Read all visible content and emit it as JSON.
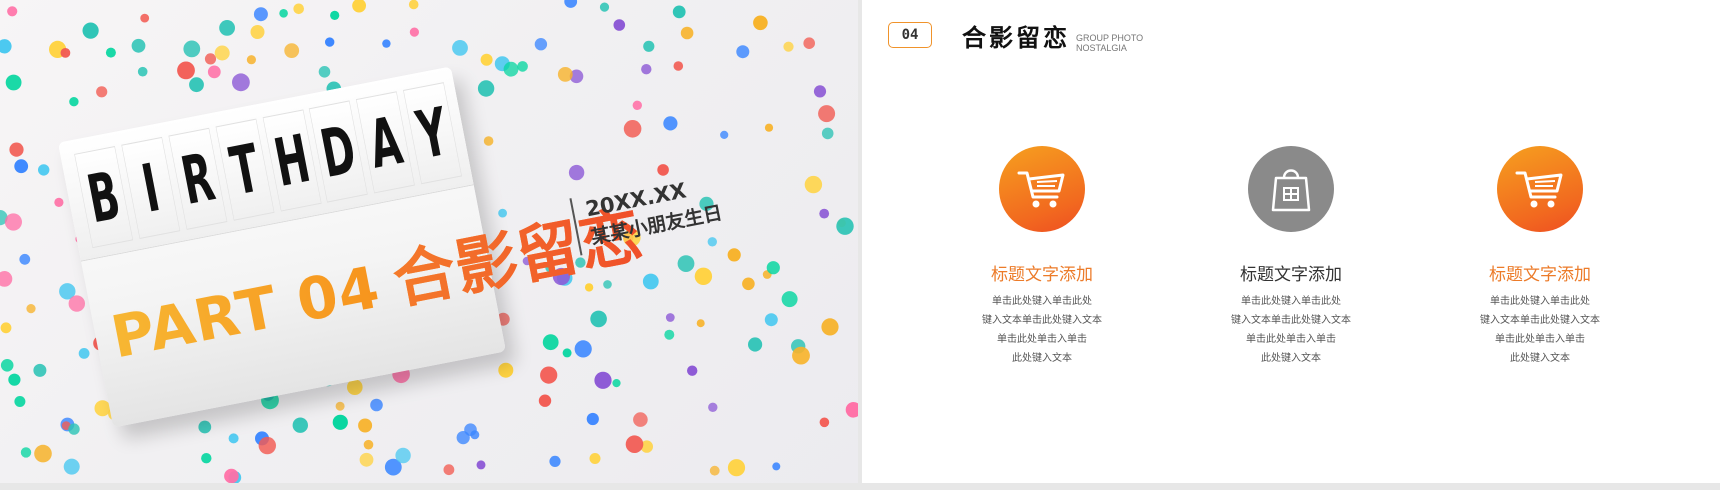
{
  "left_slide": {
    "letters": [
      "B",
      "I",
      "R",
      "T",
      "H",
      "D",
      "A",
      "Y"
    ],
    "part_label": "PART 04",
    "part_title_cn": "合影留恋",
    "date": "20XX.XX",
    "party_name": "某某小朋友生日"
  },
  "right_slide": {
    "badge": "04",
    "title": "合影留恋",
    "subtitle_line1": "GROUP PHOTO",
    "subtitle_line2": "NOSTALGIA",
    "features": [
      {
        "icon": "shopping-cart-icon",
        "title": "标题文字添加",
        "lines": [
          "单击此处键入单击此处",
          "键入文本单击此处键入文本",
          "单击此处单击入单击",
          "此处键入文本"
        ]
      },
      {
        "icon": "shopping-bag-icon",
        "title": "标题文字添加",
        "lines": [
          "单击此处键入单击此处",
          "键入文本单击此处键入文本",
          "单击此处单击入单击",
          "此处键入文本"
        ]
      },
      {
        "icon": "shopping-cart-icon",
        "title": "标题文字添加",
        "lines": [
          "单击此处键入单击此处",
          "键入文本单击此处键入文本",
          "单击此处单击入单击",
          "此处键入文本"
        ]
      }
    ]
  },
  "colors": {
    "accent_orange": "#f0932b",
    "accent_red_orange": "#ee4e22",
    "gray_icon": "#8a8a8a",
    "title_orange": "#ec7b29"
  }
}
